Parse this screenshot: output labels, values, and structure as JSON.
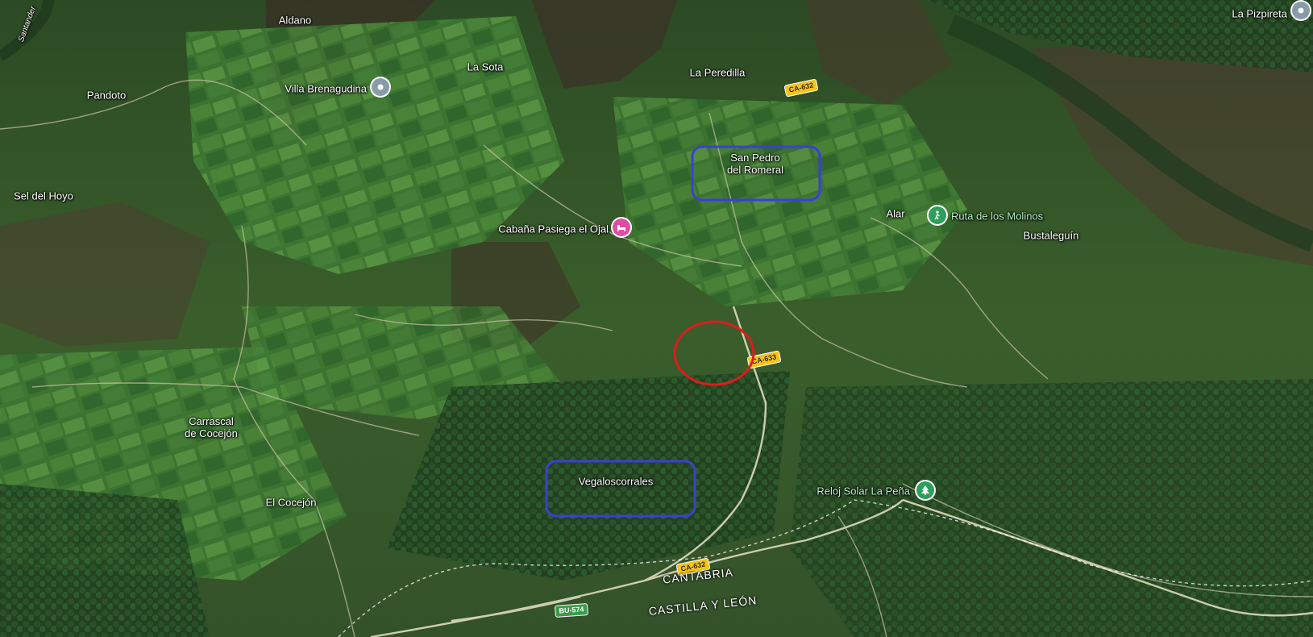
{
  "places": {
    "aldano": "Aldano",
    "la_sota": "La Sota",
    "pandoto": "Pandoto",
    "la_peredilla": "La Peredilla",
    "sel_del_hoyo": "Sel del Hoyo",
    "san_pedro_line1": "San Pedro",
    "san_pedro_line2": "del Romeral",
    "alar": "Alar",
    "bustaleguin": "Bustaleguín",
    "carrascal_line1": "Carrascal",
    "carrascal_line2": "de Cocejón",
    "el_cocejon": "El Cocejón",
    "vegaloscorrales": "Vegaloscorrales"
  },
  "pois": {
    "villa_brenagudina": {
      "label": "Villa Brenagudina",
      "icon": "place-pin-icon",
      "color": "#8a9ba8"
    },
    "cabana_pasiega": {
      "label": "Cabaña Pasiega el Ojal",
      "icon": "bed-icon",
      "color": "#e04ba5"
    },
    "ruta_molinos": {
      "label": "Ruta de los Molinos",
      "icon": "hiker-icon",
      "color": "#2e9e5b"
    },
    "reloj_solar": {
      "label": "Reloj Solar La Peña",
      "icon": "tree-icon",
      "color": "#2e9e5b"
    },
    "la_pizpireta": {
      "label": "La Pizpireta",
      "icon": "place-pin-icon",
      "color": "#8a9ba8"
    }
  },
  "roads": {
    "ca632_top": "CA-632",
    "ca633": "CA-633",
    "ca632_bottom": "CA-632",
    "bu574": "BU-574",
    "santander_label": "Santander"
  },
  "regions": {
    "cantabria": "CANTABRIA",
    "castilla_leon": "CASTILLA Y LEÓN"
  },
  "annotations": {
    "box_color": "#3b3fd6",
    "circle_color": "#e01b1b"
  }
}
